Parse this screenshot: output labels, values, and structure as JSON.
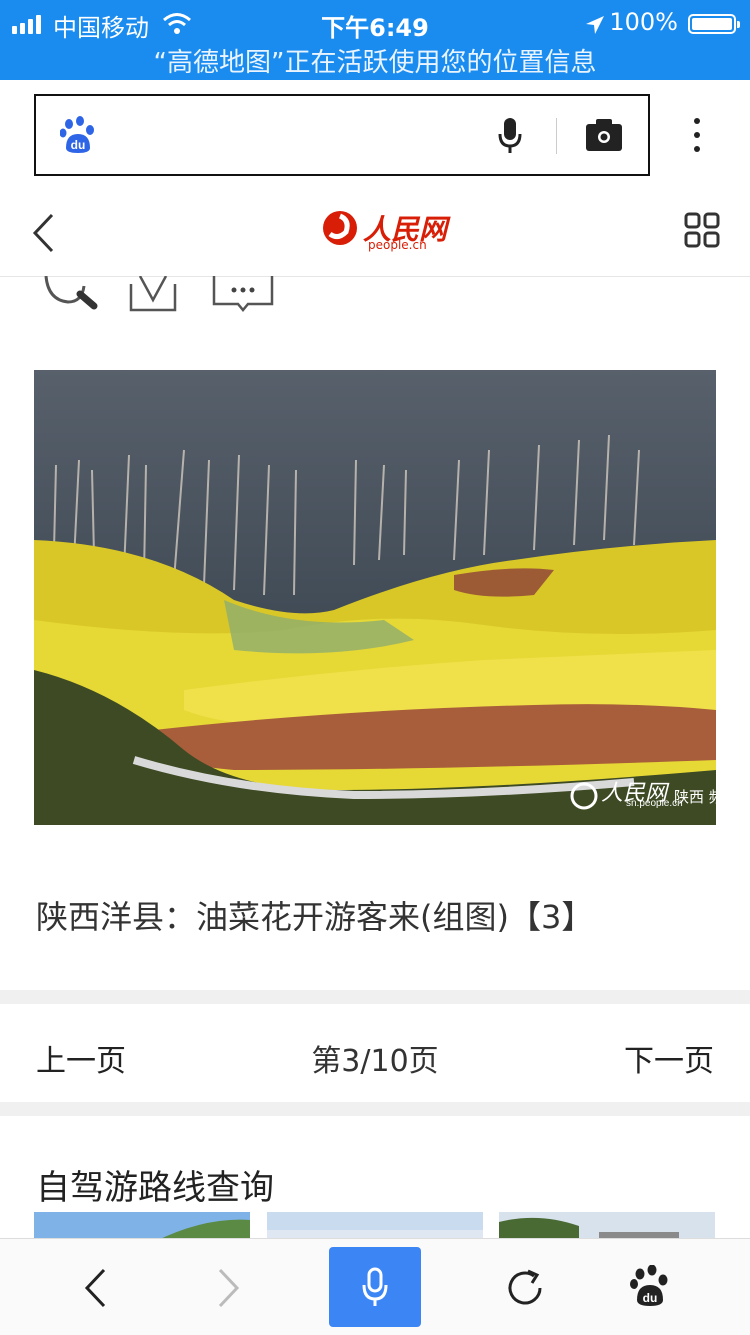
{
  "status_bar": {
    "carrier": "中国移动",
    "time": "下午6:49",
    "battery": "100%",
    "location_notice": "“高德地图”正在活跃使用您的位置信息"
  },
  "search_bar": {
    "placeholder": "",
    "icons": [
      "baidu-paw-icon",
      "microphone-icon",
      "camera-icon",
      "more-vertical-icon"
    ]
  },
  "site_header": {
    "logo_text": "人民网",
    "logo_sub": "people.cn",
    "icons": [
      "back-chevron-icon",
      "grid-menu-icon"
    ]
  },
  "article": {
    "photo_watermark": "人民网",
    "photo_watermark_side": "陕西 频道",
    "photo_watermark_url": "sn.people.cn",
    "caption": "陕西洋县：油菜花开游客来(组图)【3】"
  },
  "pager": {
    "prev": "上一页",
    "indicator": "第3/10页",
    "next": "下一页"
  },
  "related": {
    "title": "自驾游路线查询"
  },
  "toolbar": {
    "icons": [
      "back-icon",
      "forward-icon",
      "voice-icon",
      "refresh-icon",
      "baidu-home-icon"
    ]
  },
  "colors": {
    "status_bar": "#1a8cf0",
    "accent": "#3c85f5",
    "brand_red": "#d81e06"
  }
}
